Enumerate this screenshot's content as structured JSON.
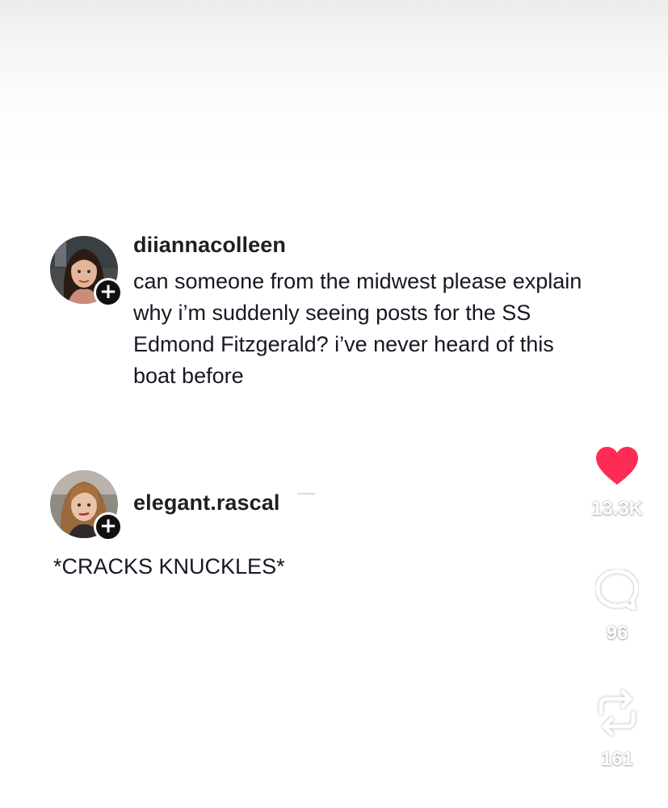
{
  "comments": [
    {
      "username": "diiannacolleen",
      "text_lines": [
        "can someone from the midwest please explain",
        "why i’m suddenly seeing posts for the SS",
        "Edmond Fitzgerald? i’ve never heard of this",
        "boat before"
      ],
      "follow_badge": "+"
    },
    {
      "username": "elegant.rascal",
      "text": "*CRACKS KNUCKLES*",
      "follow_badge": "+"
    }
  ],
  "actions": {
    "like": {
      "icon": "heart-icon",
      "count": "13.3K",
      "color": "#fe2c55"
    },
    "comment": {
      "icon": "comment-bubble-icon",
      "count": "96"
    },
    "repost": {
      "icon": "repost-icon",
      "count": "161"
    }
  }
}
